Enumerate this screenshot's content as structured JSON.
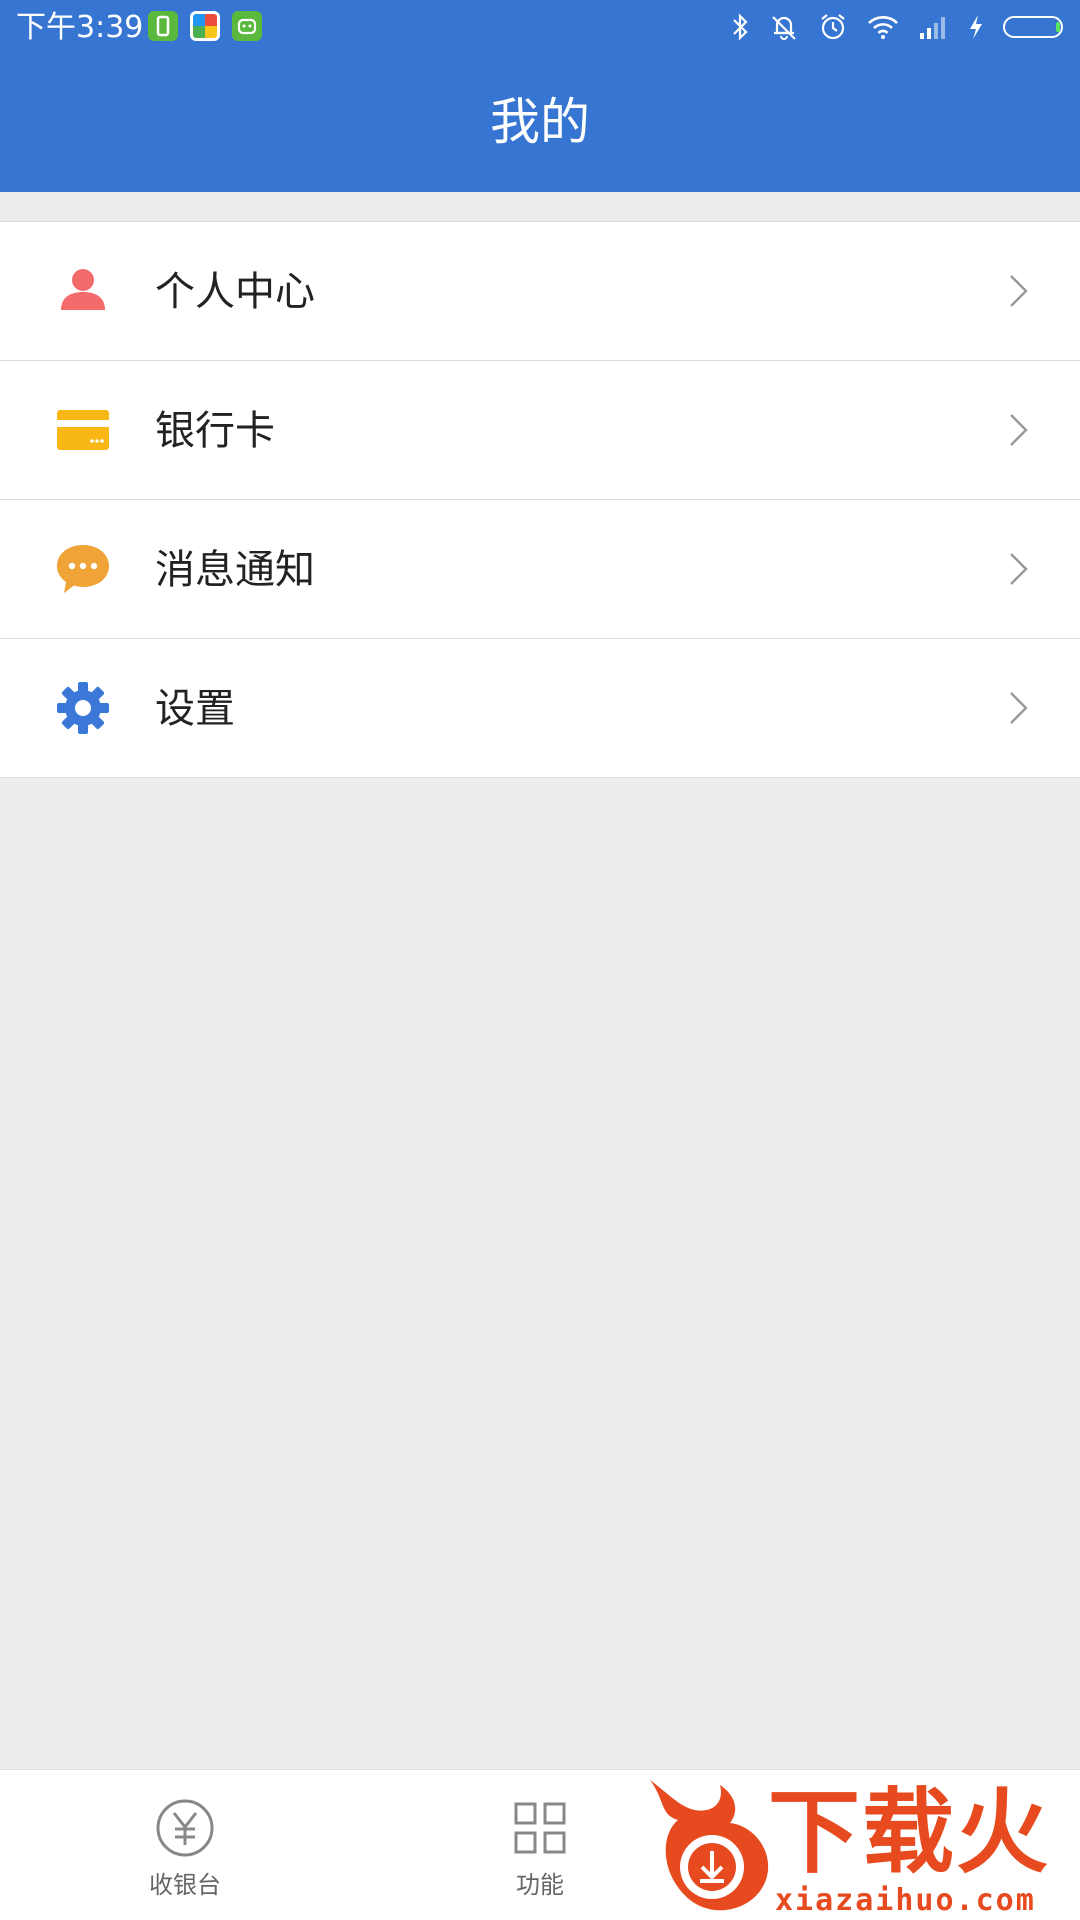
{
  "status_bar": {
    "time": "下午3:39",
    "app_icons": [
      "green-app-icon",
      "multicolor-app-icon",
      "android-app-icon"
    ],
    "indicators": [
      "bluetooth-icon",
      "mute-icon",
      "alarm-icon",
      "wifi-icon",
      "signal-icon",
      "charging-icon",
      "battery-icon"
    ]
  },
  "header": {
    "title": "我的"
  },
  "menu": {
    "items": [
      {
        "label": "个人中心",
        "icon": "person-icon",
        "color": "#f36b6b"
      },
      {
        "label": "银行卡",
        "icon": "bank-card-icon",
        "color": "#f9b716"
      },
      {
        "label": "消息通知",
        "icon": "message-icon",
        "color": "#f0a336"
      },
      {
        "label": "设置",
        "icon": "gear-icon",
        "color": "#3b78d8"
      }
    ]
  },
  "bottom_nav": {
    "tabs": [
      {
        "label": "收银台",
        "icon": "yen-circle-icon"
      },
      {
        "label": "功能",
        "icon": "grid-icon"
      }
    ]
  },
  "watermark": {
    "brand": "下载火",
    "url": "xiazaihuo.com"
  },
  "colors": {
    "primary": "#3676d2",
    "background": "#ededed",
    "watermark": "#e84a1f"
  }
}
